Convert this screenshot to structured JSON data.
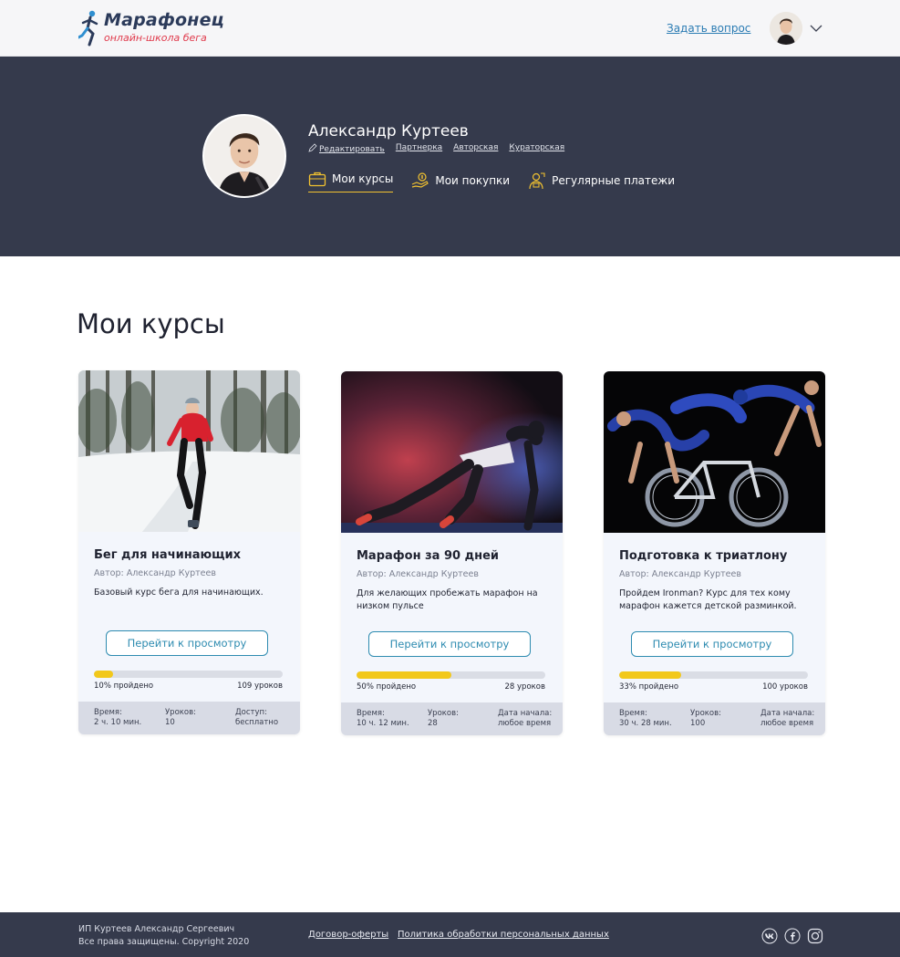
{
  "header": {
    "logo_title": "Марафонец",
    "logo_subtitle": "онлайн-школа бега",
    "ask_link": "Задать вопрос"
  },
  "profile": {
    "name": "Александр Куртеев",
    "links": [
      "Редактировать",
      "Партнерка",
      "Авторская",
      "Кураторская"
    ],
    "tabs": [
      {
        "label": "Мои курсы",
        "icon": "briefcase-icon",
        "active": true
      },
      {
        "label": "Мои покупки",
        "icon": "money-hand-icon",
        "active": false
      },
      {
        "label": "Регулярные платежи",
        "icon": "payment-person-icon",
        "active": false
      }
    ]
  },
  "main": {
    "title": "Мои курсы",
    "courses": [
      {
        "title": "Бег для начинающих",
        "author": "Автор: Александр Куртеев",
        "description": "Базовый курс бега для начинающих.",
        "button": "Перейти к просмотру",
        "progress_label": "10% пройдено",
        "progress_fraction": 0.1,
        "lessons_label": "109 уроков",
        "meta": [
          {
            "label": "Время:",
            "value": "2 ч. 10 мин."
          },
          {
            "label": "Уроков:",
            "value": "10"
          },
          {
            "label": "Доступ:",
            "value": "бесплатно"
          }
        ]
      },
      {
        "title": "Марафон за 90 дней",
        "author": "Автор: Александр Куртеев",
        "description": "Для желающих пробежать марафон на низком пульсе",
        "button": "Перейти к просмотру",
        "progress_label": "50% пройдено",
        "progress_fraction": 0.5,
        "lessons_label": "28 уроков",
        "meta": [
          {
            "label": "Время:",
            "value": "10 ч. 12 мин."
          },
          {
            "label": "Уроков:",
            "value": "28"
          },
          {
            "label": "Дата начала:",
            "value": "любое время"
          }
        ]
      },
      {
        "title": "Подготовка к триатлону",
        "author": "Автор: Александр Куртеев",
        "description": "Пройдем Ironman? Курс для тех кому марафон кажется детской разминкой.",
        "button": "Перейти к просмотру",
        "progress_label": "33% пройдено",
        "progress_fraction": 0.33,
        "lessons_label": "100 уроков",
        "meta": [
          {
            "label": "Время:",
            "value": "30 ч. 28 мин."
          },
          {
            "label": "Уроков:",
            "value": "100"
          },
          {
            "label": "Дата начала:",
            "value": "любое время"
          }
        ]
      }
    ]
  },
  "footer": {
    "owner": "ИП Куртеев Александр Сергеевич",
    "rights": "Все права защищены. Copyright 2020",
    "links": [
      "Договор-оферты",
      "Политика обработки персональных данных"
    ],
    "social": [
      "vk-icon",
      "facebook-icon",
      "instagram-icon"
    ]
  },
  "colors": {
    "dark_band": "#353a4c",
    "accent_yellow": "#f2c81b",
    "link_blue": "#2a7bb3",
    "logo_red": "#e0394b"
  }
}
